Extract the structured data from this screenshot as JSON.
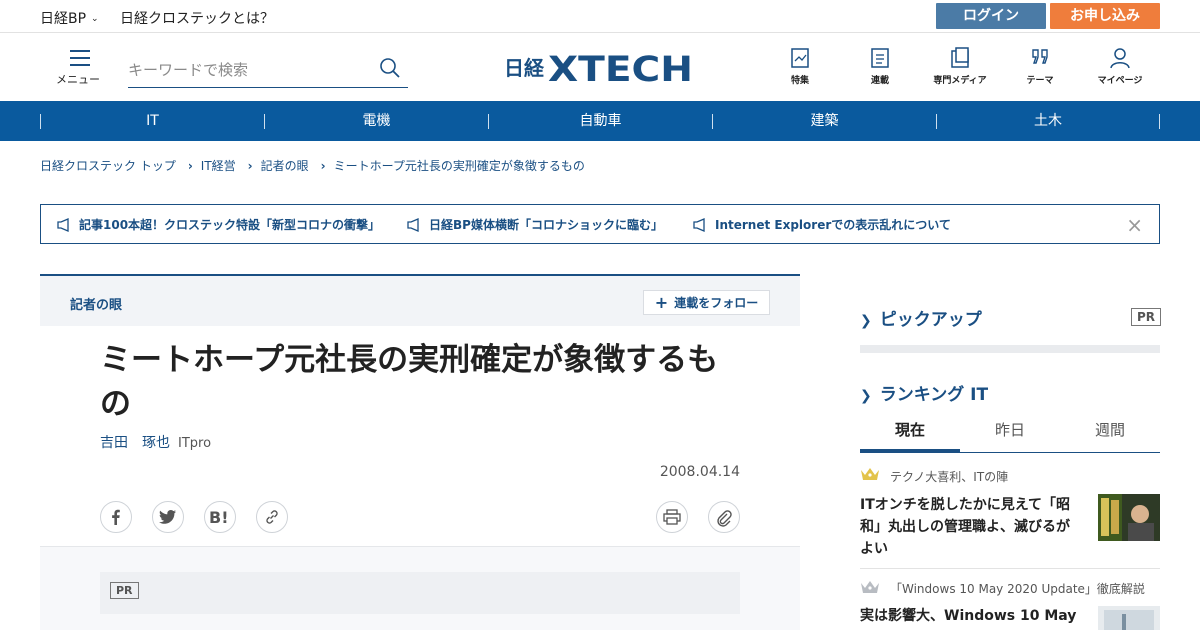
{
  "topbar": {
    "brand_menu": "日経BP",
    "about": "日経クロステックとは？",
    "login": "ログイン",
    "apply": "お申し込み"
  },
  "header": {
    "menu_label": "メニュー",
    "search_placeholder": "キーワードで検索",
    "logo_prefix": "日経",
    "logo_main": "XTECH",
    "icons": [
      {
        "label": "特集",
        "icon": "feature-icon"
      },
      {
        "label": "連載",
        "icon": "series-icon"
      },
      {
        "label": "専門メディア",
        "icon": "media-icon"
      },
      {
        "label": "テーマ",
        "icon": "theme-icon"
      },
      {
        "label": "マイページ",
        "icon": "user-icon"
      }
    ]
  },
  "categories": [
    "IT",
    "電機",
    "自動車",
    "建築",
    "土木"
  ],
  "breadcrumb": [
    "日経クロステック トップ",
    "IT経営",
    "記者の眼",
    "ミートホープ元社長の実刑確定が象徴するもの"
  ],
  "notices": [
    "記事100本超！クロステック特設「新型コロナの衝撃」",
    "日経BP媒体横断「コロナショックに臨む」",
    "Internet Explorerでの表示乱れについて"
  ],
  "notice_close": "×",
  "article": {
    "series": "記者の眼",
    "follow_label": "連載をフォロー",
    "title": "ミートホープ元社長の実刑確定が象徴するもの",
    "author": "吉田　琢也",
    "source": "ITpro",
    "date": "2008.04.14",
    "share_icons": [
      "facebook-icon",
      "twitter-icon",
      "hatena-bookmark-icon",
      "link-icon"
    ],
    "tool_icons": [
      "print-icon",
      "clip-icon"
    ],
    "pr_badge": "PR"
  },
  "sidebar": {
    "pickup_heading": "ピックアップ",
    "pickup_pr": "PR",
    "ranking_heading": "ランキング IT",
    "ranking_tabs": [
      "現在",
      "昨日",
      "週間"
    ],
    "ranking_items": [
      {
        "series": "テクノ大喜利、ITの陣",
        "title": "ITオンチを脱したかに見えて「昭和」丸出しの管理職よ、滅びるがよい",
        "crown_color": "#e3c34a"
      },
      {
        "series": "「Windows 10 May 2020 Update」徹底解説",
        "title": "実は影響大、Windows 10 May",
        "crown_color": "#b8bcc2"
      }
    ]
  },
  "colors": {
    "brand_blue": "#1a4f83",
    "category_bar": "#0a5a9e",
    "login_button": "#4b7ba6",
    "apply_button": "#ef7d3c"
  }
}
